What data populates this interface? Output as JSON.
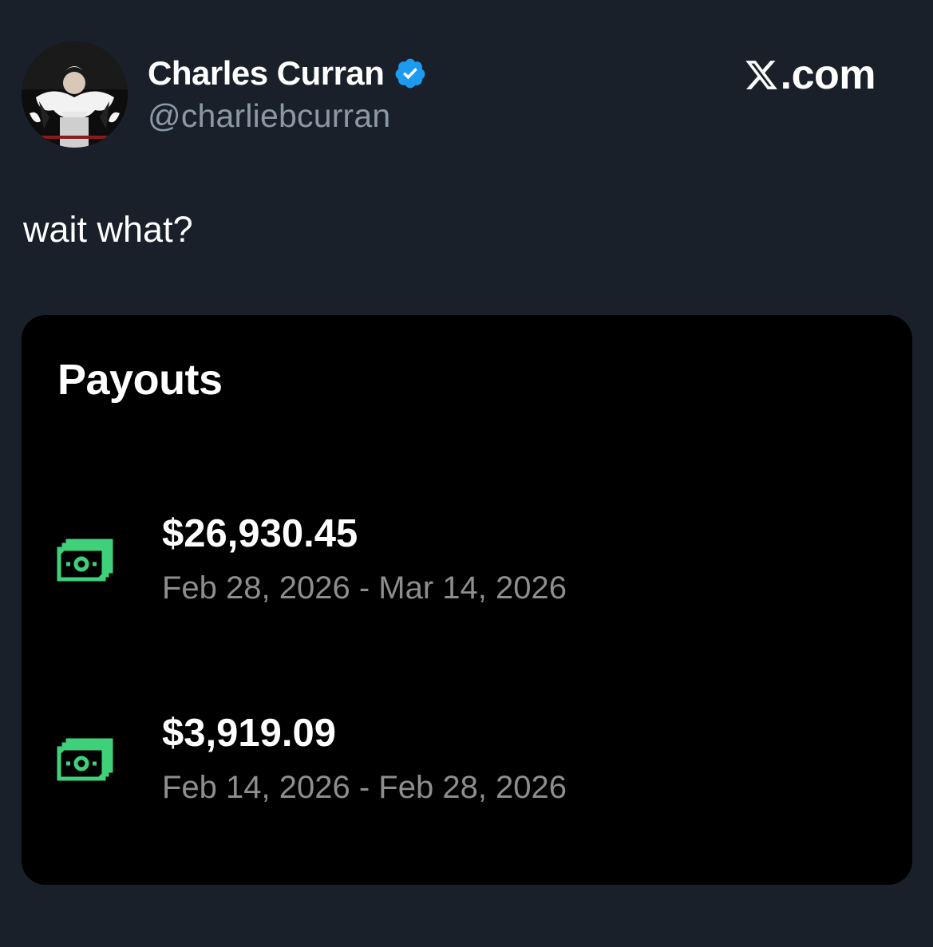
{
  "tweet": {
    "author": {
      "display_name": "Charles Curran",
      "handle": "@charliebcurran",
      "verified": true
    },
    "brand": {
      "icon": "x-logo-icon",
      "text": ".com"
    },
    "text": "wait what?"
  },
  "payouts_card": {
    "title": "Payouts",
    "items": [
      {
        "icon": "money-icon",
        "amount": "$26,930.45",
        "dates": "Feb 28, 2026 - Mar 14, 2026"
      },
      {
        "icon": "money-icon",
        "amount": "$3,919.09",
        "dates": "Feb 14, 2026 - Feb 28, 2026"
      }
    ]
  },
  "colors": {
    "background": "#19202a",
    "card_background": "#000000",
    "handle_gray": "#8b98a5",
    "date_gray": "#8e8e8e",
    "verified_blue": "#1d9bf0",
    "money_green": "#3ed17a"
  }
}
